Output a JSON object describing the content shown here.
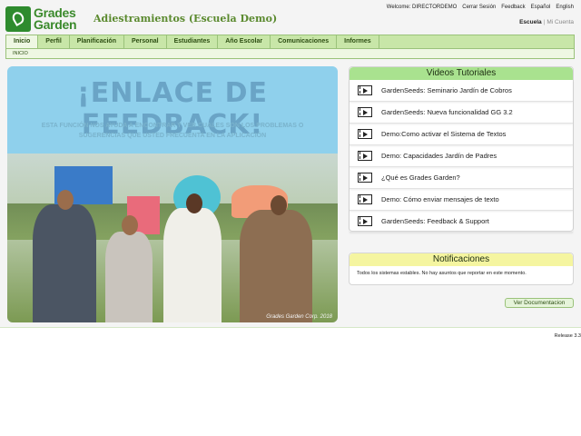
{
  "header": {
    "logo_top": "Grades",
    "logo_bottom": "Garden",
    "school": "Adiestramientos (Escuela Demo)",
    "welcome": "Welcome: DIRECTORDEMO",
    "logout": "Cerrar Sesión",
    "feedback": "Feedback",
    "lang_es": "Español",
    "lang_en": "English",
    "acct_school": "Escuela",
    "acct_mine": "Mi Cuenta"
  },
  "nav": {
    "tabs": [
      "Inicio",
      "Perfil",
      "Planificación",
      "Personal",
      "Estudiantes",
      "Año Escolar",
      "Comunicaciones",
      "Informes"
    ],
    "active_tab": "Inicio",
    "breadcrumb": "INICIO"
  },
  "banner": {
    "title": "¡ENLACE DE FEEDBACK!",
    "subtitle": "ESTA FUNCIÓN NOS AYUDA A ENCONTRAR Y VER CUALES SON LOS PROBLEMAS O SUGERENCIAS QUE USTED FRECUENTA EN LA APLICACIÓN",
    "credit": "Grades Garden Corp. 2018"
  },
  "videos": {
    "title": "Videos Tutoriales",
    "items": [
      "GardenSeeds: Seminario Jardín de Cobros",
      "GardenSeeds: Nueva funcionalidad GG 3.2",
      "Demo:Como activar el Sistema de Textos",
      "Demo: Capacidades Jardín de Padres",
      "¿Qué es Grades Garden?",
      "Demo: Cómo enviar mensajes de texto",
      "GardenSeeds: Feedback & Support"
    ]
  },
  "notifications": {
    "title": "Notificaciones",
    "message": "Todos los sistemas estables. No hay asuntos que reportar en este momento."
  },
  "doc_button": "Ver Documentacion",
  "release": "Release 3.3",
  "colors": {
    "nav_green": "#c8e6a8",
    "video_head": "#a9e28f",
    "notif_head": "#f5f5a0"
  }
}
